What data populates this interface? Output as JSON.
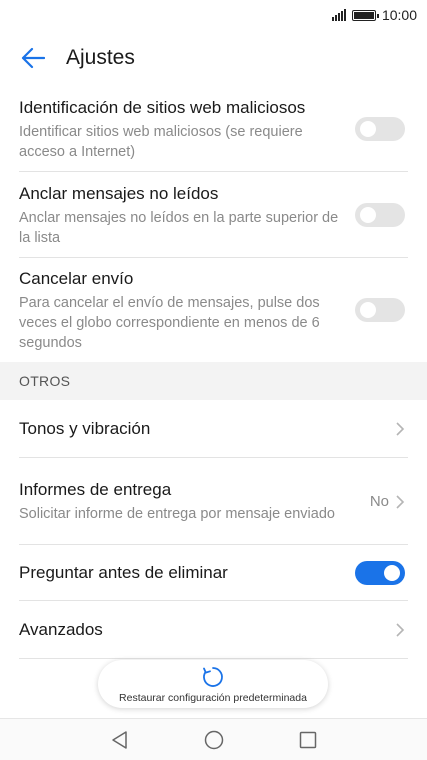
{
  "status": {
    "time": "10:00"
  },
  "header": {
    "title": "Ajustes"
  },
  "items": [
    {
      "title": "Identificación de sitios web maliciosos",
      "subtitle": "Identificar sitios web maliciosos (se requiere acceso a Internet)",
      "toggle": false
    },
    {
      "title": "Anclar mensajes no leídos",
      "subtitle": "Anclar mensajes no leídos en la parte superior de la lista",
      "toggle": false
    },
    {
      "title": "Cancelar envío",
      "subtitle": "Para cancelar el envío de mensajes, pulse dos veces el globo correspondiente en menos de 6 segundos",
      "toggle": false
    }
  ],
  "section_otros": {
    "label": "OTROS"
  },
  "otros": {
    "tonos": {
      "title": "Tonos y vibración"
    },
    "informes": {
      "title": "Informes de entrega",
      "subtitle": "Solicitar informe de entrega por mensaje enviado",
      "value": "No"
    },
    "preguntar": {
      "title": "Preguntar antes de eliminar",
      "toggle": true
    },
    "avanzados": {
      "title": "Avanzados"
    }
  },
  "restore": {
    "label": "Restaurar configuración predeterminada"
  },
  "colors": {
    "accent": "#1a73e8",
    "toggle_off": "#e4e4e4",
    "section_bg": "#f3f3f3"
  },
  "icons": [
    "signal-icon",
    "battery-icon",
    "back-arrow-icon",
    "chevron-right-icon",
    "refresh-icon",
    "nav-back-icon",
    "nav-home-icon",
    "nav-recents-icon"
  ]
}
